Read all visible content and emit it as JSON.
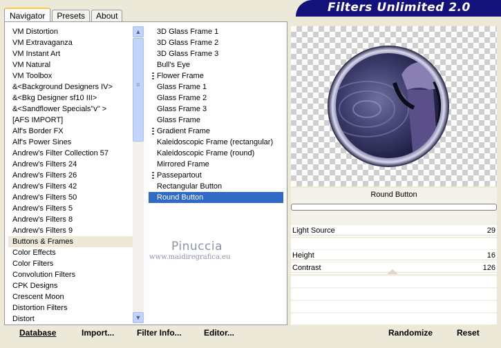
{
  "tabs": [
    "Navigator",
    "Presets",
    "About"
  ],
  "banner_title": "Filters Unlimited 2.0",
  "categories": [
    "VM Distortion",
    "VM Extravaganza",
    "VM Instant Art",
    "VM Natural",
    "VM Toolbox",
    "&<Background Designers IV>",
    "&<Bkg Designer sf10 III>",
    "&<Sandflower Specials\"v\" >",
    "[AFS IMPORT]",
    "Alf's Border FX",
    "Alf's Power Sines",
    "Andrew's Filter Collection 57",
    "Andrew's Filters 24",
    "Andrew's Filters 26",
    "Andrew's Filters 42",
    "Andrew's Filters 50",
    "Andrew's Filters 5",
    "Andrew's Filters 8",
    "Andrew's Filters 9",
    "Buttons & Frames",
    "Color Effects",
    "Color Filters",
    "Convolution Filters",
    "CPK Designs",
    "Crescent Moon",
    "Distortion Filters",
    "Distort"
  ],
  "selected_category_index": 19,
  "filters": [
    {
      "label": "3D Glass Frame 1",
      "group": false
    },
    {
      "label": "3D Glass Frame 2",
      "group": false
    },
    {
      "label": "3D Glass Frame 3",
      "group": false
    },
    {
      "label": "Bull's Eye",
      "group": false
    },
    {
      "label": "Flower Frame",
      "group": true
    },
    {
      "label": "Glass Frame 1",
      "group": false
    },
    {
      "label": "Glass Frame 2",
      "group": false
    },
    {
      "label": "Glass Frame 3",
      "group": false
    },
    {
      "label": "Glass Frame",
      "group": false
    },
    {
      "label": "Gradient Frame",
      "group": true
    },
    {
      "label": "Kaleidoscopic Frame (rectangular)",
      "group": false
    },
    {
      "label": "Kaleidoscopic Frame (round)",
      "group": false
    },
    {
      "label": "Mirrored Frame",
      "group": false
    },
    {
      "label": "Passepartout",
      "group": true
    },
    {
      "label": "Rectangular Button",
      "group": false
    },
    {
      "label": "Round Button",
      "group": false
    }
  ],
  "selected_filter_index": 15,
  "watermark": {
    "name": "Pinuccia",
    "url": "www.maidiregrafica.eu"
  },
  "bottom_buttons": {
    "database": "Database",
    "import": "Import...",
    "filter_info": "Filter Info...",
    "editor": "Editor...",
    "randomize": "Randomize",
    "reset": "Reset"
  },
  "selected_filter_name": "Round Button",
  "parameters": [
    {
      "label": "Light Source",
      "value": "29"
    },
    {
      "label": "Height",
      "value": "16"
    },
    {
      "label": "Contrast",
      "value": "126"
    }
  ],
  "colors": {
    "banner": "#12127a",
    "selection": "#316ac5",
    "tab_highlight": "#ffc83c"
  },
  "icons": {
    "scroll_up": "scroll-up-arrow-icon",
    "scroll_down": "scroll-down-arrow-icon"
  }
}
